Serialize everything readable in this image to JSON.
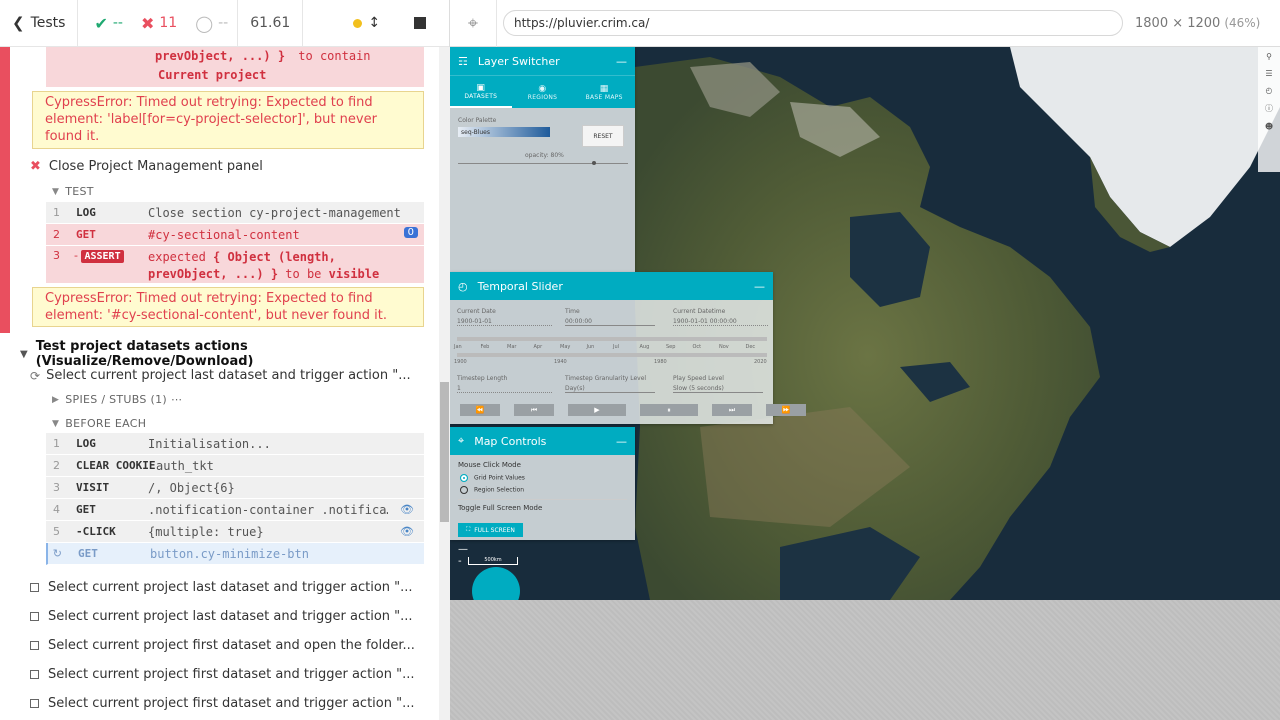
{
  "reporter": {
    "tests_label": "Tests",
    "passed": "--",
    "failed": "11",
    "pending": "--",
    "duration": "61.61",
    "assert_prev": {
      "line1": "prevObject, ...) }",
      "line1_suffix": "to contain",
      "line2": "Current project"
    },
    "error1": "CypressError: Timed out retrying: Expected to find element: 'label[for=cy-project-selector]', but never found it.",
    "test_close": "Close Project Management panel",
    "section_test": "TEST",
    "test_cmds": [
      {
        "num": "1",
        "name": "LOG",
        "msg": "Close section cy-project-management"
      },
      {
        "num": "2",
        "name": "GET",
        "msg": "#cy-sectional-content",
        "badge": "0"
      },
      {
        "num": "3",
        "name": "ASSERT",
        "msg_prefix": "expected",
        "msg_bold": "{ Object (length,",
        "msg_line2": "prevObject, ...) }",
        "msg_line2_mid": "to be",
        "msg_line2_end": "visible"
      }
    ],
    "error2": "CypressError: Timed out retrying: Expected to find element: '#cy-sectional-content', but never found it.",
    "suite_title": "Test project datasets actions (Visualize/Remove/Download)",
    "running_test": "Select current project last dataset and trigger action \"...",
    "spies_label": "SPIES / STUBS (1)",
    "before_each_label": "BEFORE EACH",
    "before_cmds": [
      {
        "num": "1",
        "name": "LOG",
        "msg": "Initialisation..."
      },
      {
        "num": "2",
        "name": "CLEAR COOKIE",
        "msg": "auth_tkt"
      },
      {
        "num": "3",
        "name": "VISIT",
        "msg": "/, Object{6}"
      },
      {
        "num": "4",
        "name": "GET",
        "msg": ".notification-container .notifica…"
      },
      {
        "num": "5",
        "name": "-CLICK",
        "msg": "{multiple: true}"
      },
      {
        "num": "",
        "name": "GET",
        "msg": "button.cy-minimize-btn"
      }
    ],
    "pending_tests": [
      "Select current project last dataset and trigger action \"...",
      "Select current project last dataset and trigger action \"...",
      "Select current project first dataset and open the folder...",
      "Select current project first dataset and trigger action \"...",
      "Select current project first dataset and trigger action \"..."
    ]
  },
  "aut": {
    "url": "https://pluvier.crim.ca/",
    "viewport": "1800 × 1200",
    "scale": "(46%)"
  },
  "app": {
    "layer_switcher": {
      "title": "Layer Switcher",
      "tabs": [
        "DATASETS",
        "REGIONS",
        "BASE MAPS"
      ],
      "color_palette_label": "Color Palette",
      "palette_value": "seq-Blues",
      "reset_label": "RESET",
      "opacity_label": "opacity: 80%"
    },
    "temporal_slider": {
      "title": "Temporal Slider",
      "current_date_label": "Current Date",
      "current_date": "1900-01-01",
      "time_label": "Time",
      "time_value": "00:00:00",
      "current_datetime_label": "Current Datetime",
      "current_datetime": "1900-01-01 00:00:00",
      "months": [
        "Jan",
        "Feb",
        "Mar",
        "Apr",
        "May",
        "Jun",
        "Jul",
        "Aug",
        "Sep",
        "Oct",
        "Nov",
        "Dec"
      ],
      "years": [
        "1900",
        "1940",
        "1980",
        "2020"
      ],
      "timestep_length_label": "Timestep Length",
      "timestep_length": "1",
      "granularity_label": "Timestep Granularity Level",
      "granularity": "Day(s)",
      "play_speed_label": "Play Speed Level",
      "play_speed": "Slow (5 seconds)"
    },
    "map_controls": {
      "title": "Map Controls",
      "mouse_click_label": "Mouse Click Mode",
      "option_grid": "Grid Point Values",
      "option_region": "Region Selection",
      "toggle_label": "Toggle Full Screen Mode",
      "fullscreen_label": "FULL SCREEN"
    },
    "scale_label": "500km"
  },
  "colors": {
    "accent": "#00acc1",
    "fail": "#e94f5f",
    "pass": "#1fa971"
  }
}
